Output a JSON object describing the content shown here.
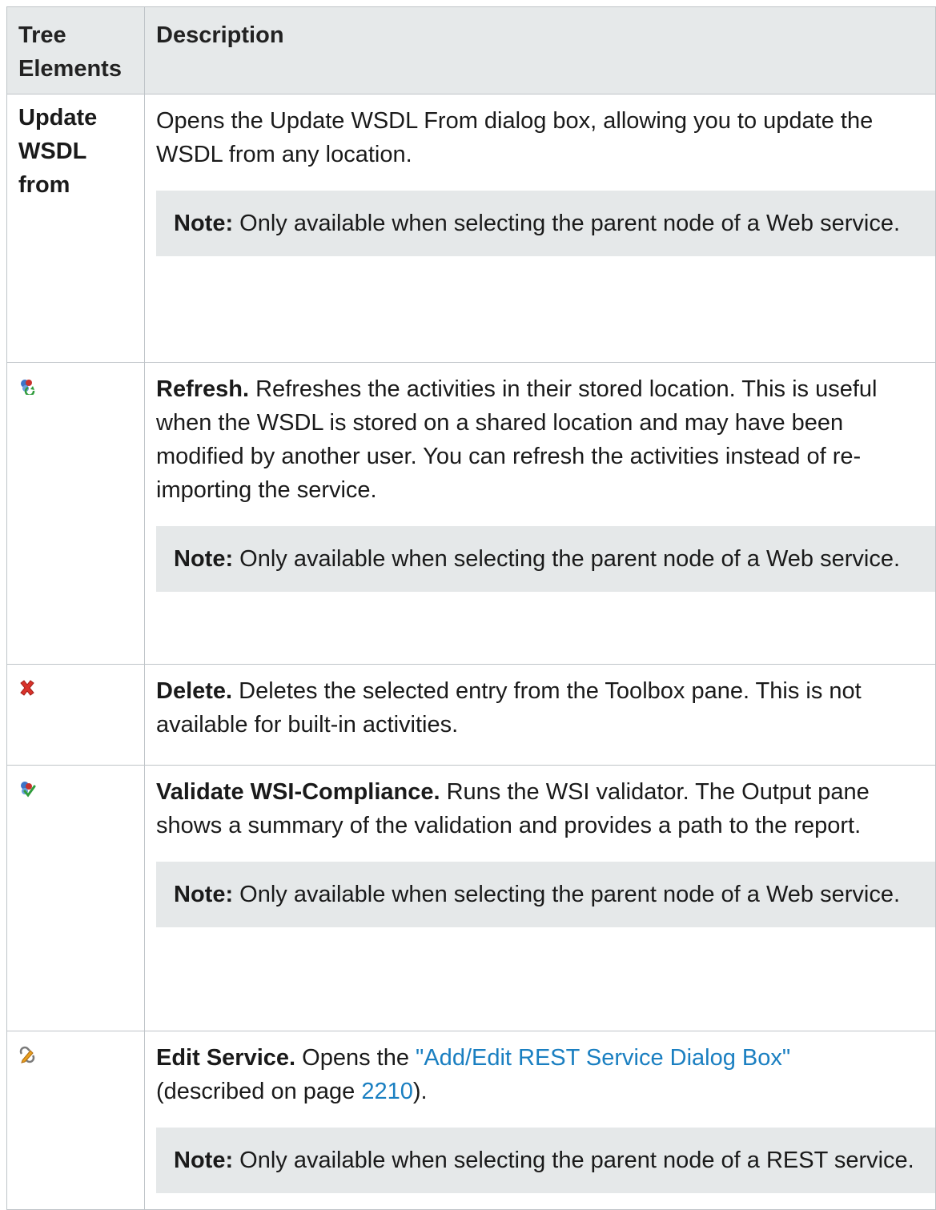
{
  "table": {
    "headers": {
      "col1": "Tree Elements",
      "col2": "Description"
    },
    "rows": [
      {
        "element": "Update WSDL from",
        "icon": null,
        "title": "",
        "text": "Opens the Update WSDL From dialog box, allowing you to update the WSDL from any location.",
        "note_label": "Note:",
        "note": "Only available when selecting the parent node of a Web service."
      },
      {
        "element": "",
        "icon": "refresh-icon",
        "title": "Refresh.",
        "text": "Refreshes the activities in their stored location. This is useful when the WSDL is stored on a shared location and may have been modified by another user. You can refresh the activities instead of re-importing the service.",
        "note_label": "Note:",
        "note": "Only available when selecting the parent node of a Web service."
      },
      {
        "element": "",
        "icon": "delete-icon",
        "title": "Delete.",
        "text": "Deletes the selected entry from the Toolbox pane. This is not available for built-in activities."
      },
      {
        "element": "",
        "icon": "validate-icon",
        "title": "Validate WSI-Compliance.",
        "text": "Runs the WSI validator. The Output pane shows a summary of the validation and provides a path to the report.",
        "note_label": "Note:",
        "note": "Only available when selecting the parent node of a Web service."
      },
      {
        "element": "",
        "icon": "edit-service-icon",
        "title": "Edit Service.",
        "text_before": "Opens the",
        "link_text": "\"Add/Edit REST Service Dialog Box\"",
        "text_middle": "(described on page",
        "page_link": "2210",
        "text_after": ").",
        "note_label": "Note:",
        "note": "Only available when selecting the parent node of a REST service."
      }
    ]
  },
  "colors": {
    "header_bg": "#e6e9ea",
    "note_bg": "#e5e8e9",
    "border": "#bfc4c8",
    "link": "#1a7fc1"
  }
}
